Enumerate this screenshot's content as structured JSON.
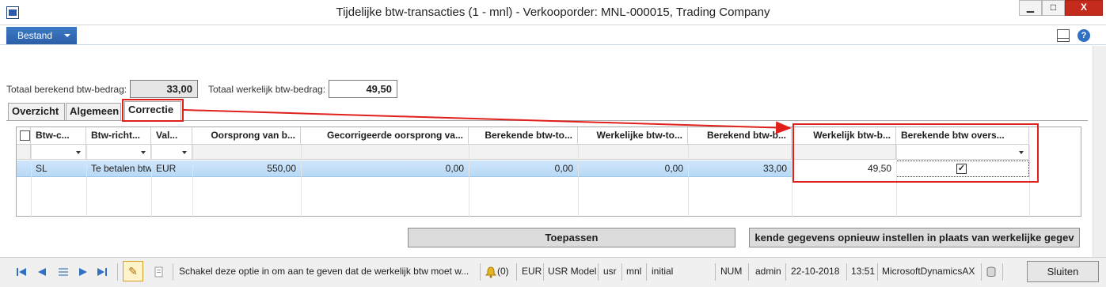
{
  "window": {
    "title": "Tijdelijke btw-transacties (1 - mnl) - Verkooporder: MNL-000015, Trading Company",
    "minimize": "▁",
    "maximize": "□",
    "close": "X"
  },
  "ribbon": {
    "file_label": "Bestand",
    "help": "?"
  },
  "totals": {
    "calculated_label": "Totaal berekend btw-bedrag:",
    "calculated_value": "33,00",
    "actual_label": "Totaal werkelijk btw-bedrag:",
    "actual_value": "49,50"
  },
  "tabs": [
    {
      "label": "Overzicht"
    },
    {
      "label": "Algemeen"
    },
    {
      "label": "Correctie"
    }
  ],
  "grid": {
    "headers": [
      "Btw-c...",
      "Btw-richt...",
      "Val...",
      "Oorsprong van b...",
      "Gecorrigeerde oorsprong va...",
      "Berekende btw-to...",
      "Werkelijke btw-to...",
      "Berekend btw-b...",
      "Werkelijk btw-b...",
      "Berekende btw overs..."
    ],
    "row": {
      "code": "SL",
      "direction": "Te betalen btw",
      "currency": "EUR",
      "origin": "550,00",
      "corrected_origin": "0,00",
      "calc_total": "0,00",
      "actual_total": "0,00",
      "calc_amount": "33,00",
      "actual_amount": "49,50",
      "override_check": "✓"
    }
  },
  "buttons": {
    "apply": "Toepassen",
    "reset": "kende gegevens opnieuw instellen in plaats van werkelijke gegev"
  },
  "statusbar": {
    "help_text": "Schakel deze optie in om aan te geven dat de werkelijk btw moet w...",
    "notifications": "(0)",
    "currency": "EUR",
    "model": "USR Model",
    "layer": "usr",
    "company": "mnl",
    "partition": "initial",
    "num": "NUM",
    "user": "admin",
    "date": "22-10-2018",
    "time": "13:51",
    "aos": "MicrosoftDynamicsAX",
    "close_label": "Sluiten"
  },
  "colors": {
    "annotation": "#e0201a",
    "selected_row": "#c4e0f8",
    "file_button": "#2b5fa8"
  }
}
